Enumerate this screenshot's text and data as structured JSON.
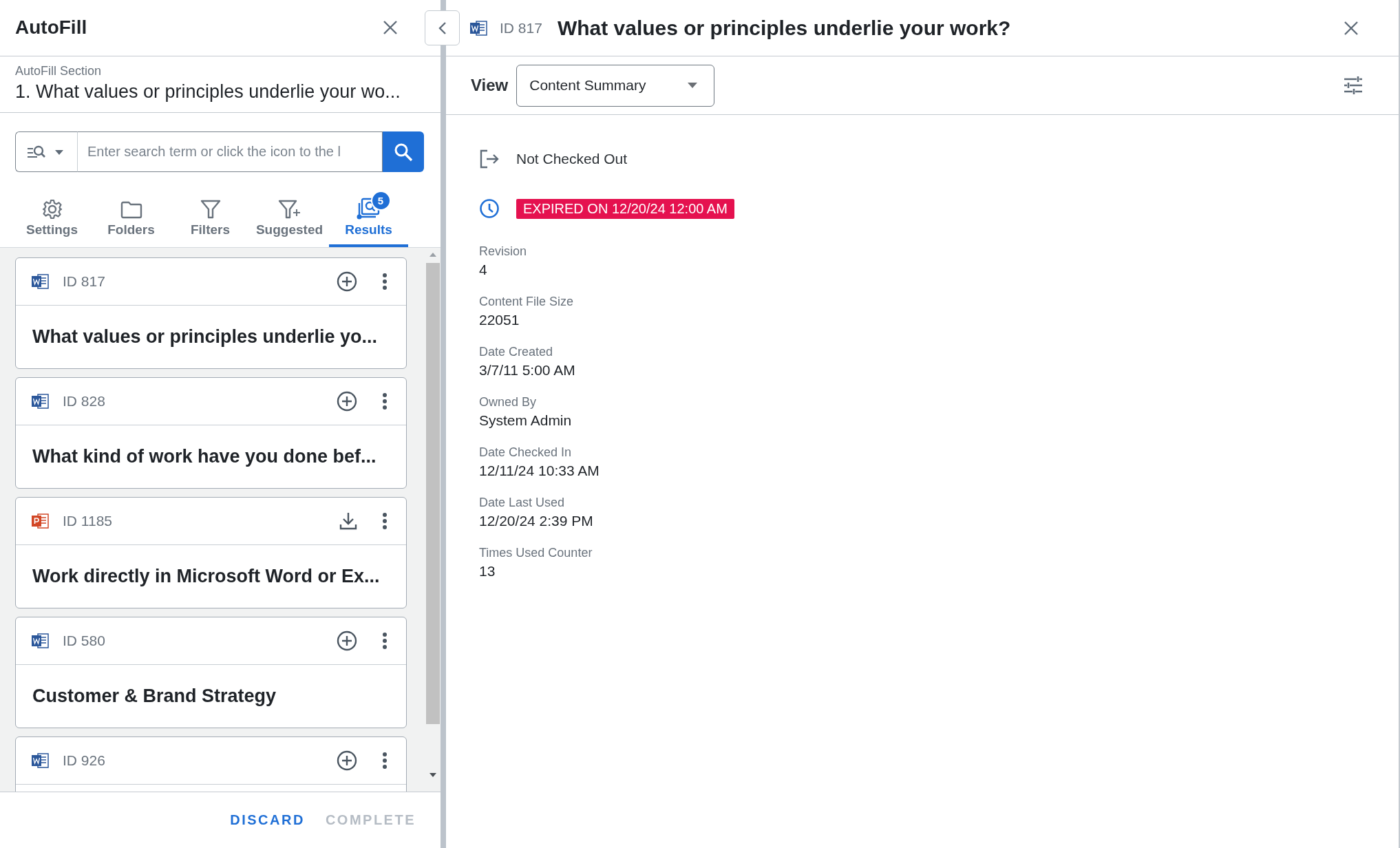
{
  "autofill_panel": {
    "title": "AutoFill",
    "section": {
      "label": "AutoFill Section",
      "value": "1. What values or principles underlie your wo..."
    },
    "search": {
      "placeholder": "Enter search term or click the icon to the l"
    },
    "tabs": [
      {
        "label": "Settings",
        "selected": false
      },
      {
        "label": "Folders",
        "selected": false
      },
      {
        "label": "Filters",
        "selected": false
      },
      {
        "label": "Suggested",
        "selected": false
      },
      {
        "label": "Results",
        "selected": true,
        "badge": "5"
      }
    ],
    "results": [
      {
        "kind": "word",
        "id": "ID 817",
        "title": "What values or principles underlie yo..."
      },
      {
        "kind": "word",
        "id": "ID 828",
        "title": "What kind of work have you done bef..."
      },
      {
        "kind": "powerpoint",
        "id": "ID 1185",
        "title": "Work directly in Microsoft Word or Ex..."
      },
      {
        "kind": "word",
        "id": "ID 580",
        "title": "Customer & Brand Strategy"
      },
      {
        "kind": "word",
        "id": "ID 926"
      }
    ],
    "buttons": [
      {
        "label": "DISCARD",
        "disabled": false
      },
      {
        "label": "COMPLETE",
        "disabled": true
      }
    ]
  },
  "content_panel": {
    "kind": "word",
    "id": "ID 817",
    "title": "What values or principles underlie your work?",
    "view": {
      "label": "View",
      "value": "Content Summary"
    },
    "status": [
      {
        "kind": "checkout",
        "text": "Not Checked Out"
      },
      {
        "kind": "expiry",
        "text": "EXPIRED ON 12/20/24 12:00 AM"
      }
    ],
    "fields": [
      {
        "label": "Revision",
        "value": "4"
      },
      {
        "label": "Content File Size",
        "value": "22051"
      },
      {
        "label": "Date Created",
        "value": "3/7/11 5:00 AM"
      },
      {
        "label": "Owned By",
        "value": "System Admin"
      },
      {
        "label": "Date Checked In",
        "value": "12/11/24 10:33 AM"
      },
      {
        "label": "Date Last Used",
        "value": "12/20/24 2:39 PM"
      },
      {
        "label": "Times Used Counter",
        "value": "13"
      }
    ]
  }
}
